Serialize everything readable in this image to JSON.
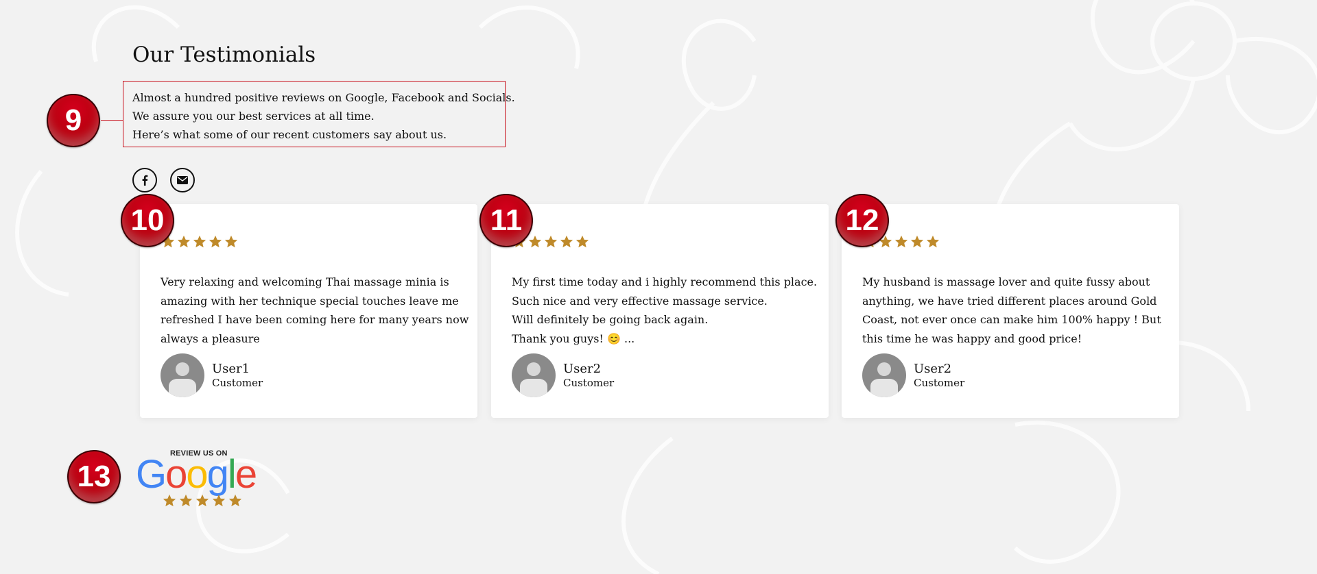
{
  "section": {
    "title": "Our Testimonials",
    "intro_lines": [
      "Almost a hundred positive reviews on Google, Facebook and Socials.",
      "We assure you our best services at all time.",
      "Here’s what some of our recent customers say about us."
    ]
  },
  "social": {
    "facebook_icon": "facebook-icon",
    "email_icon": "envelope-icon"
  },
  "callouts": [
    "9",
    "10",
    "11",
    "12",
    "13"
  ],
  "rating_stars": 5,
  "testimonials": [
    {
      "lines": [
        "Very relaxing and welcoming Thai massage minia is",
        "amazing with her technique special touches leave me",
        "refreshed I have been coming here for many years now",
        "always a pleasure"
      ],
      "name": "User1",
      "role": "Customer"
    },
    {
      "lines": [
        "My first time today and i highly recommend this place.",
        "Such nice and very effective massage service.",
        "Will definitely be going back again.",
        "Thank you guys! 😊 ..."
      ],
      "name": "User2",
      "role": "Customer"
    },
    {
      "lines": [
        "My husband is massage lover and quite fussy about",
        "anything, we have tried different places around Gold",
        "Coast, not ever once can make him 100% happy ! But",
        "this time he was happy and good price!"
      ],
      "name": "User2",
      "role": "Customer"
    }
  ],
  "google_badge": {
    "review_label": "REVIEW US ON",
    "word": "Google",
    "stars": 5
  },
  "colors": {
    "star": "#bf8a2a",
    "callout": "#c0000f",
    "highlight_border": "#c8101c",
    "google_blue": "#4285F4",
    "google_red": "#EA4335",
    "google_yellow": "#FBBC05",
    "google_green": "#34A853"
  }
}
